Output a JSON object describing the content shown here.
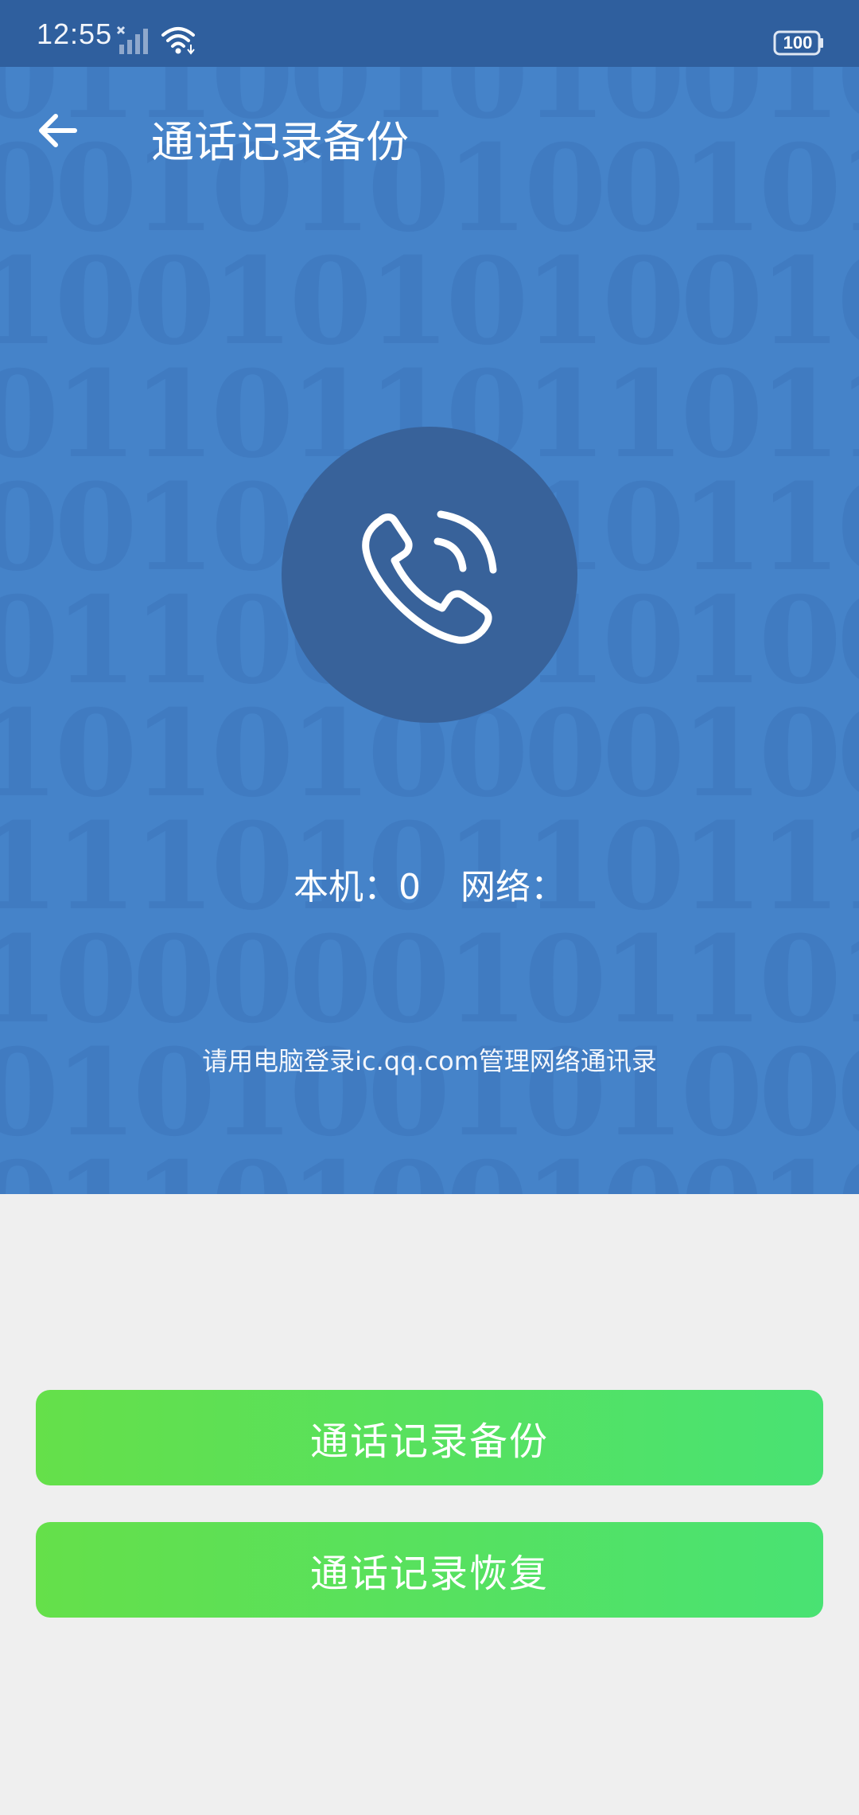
{
  "status_bar": {
    "time": "12:55",
    "battery": "100",
    "icons": [
      "signal-icon",
      "wifi-icon",
      "battery-icon"
    ]
  },
  "header": {
    "title": "通话记录备份",
    "back_icon": "back-arrow-icon"
  },
  "hero": {
    "icon": "phone-call-icon",
    "local_label": "本机：",
    "local_count": "0",
    "network_label": "网络：",
    "network_count": "",
    "hint": "请用电脑登录ic.qq.com管理网络通讯录"
  },
  "actions": {
    "backup_label": "通话记录备份",
    "restore_label": "通话记录恢复"
  },
  "colors": {
    "status_bar": "#2f5f9e",
    "hero_bg": "#4583c9",
    "circle": "#38629a",
    "button_start": "#65e04a",
    "button_end": "#49e273",
    "page_bg": "#efefef"
  }
}
